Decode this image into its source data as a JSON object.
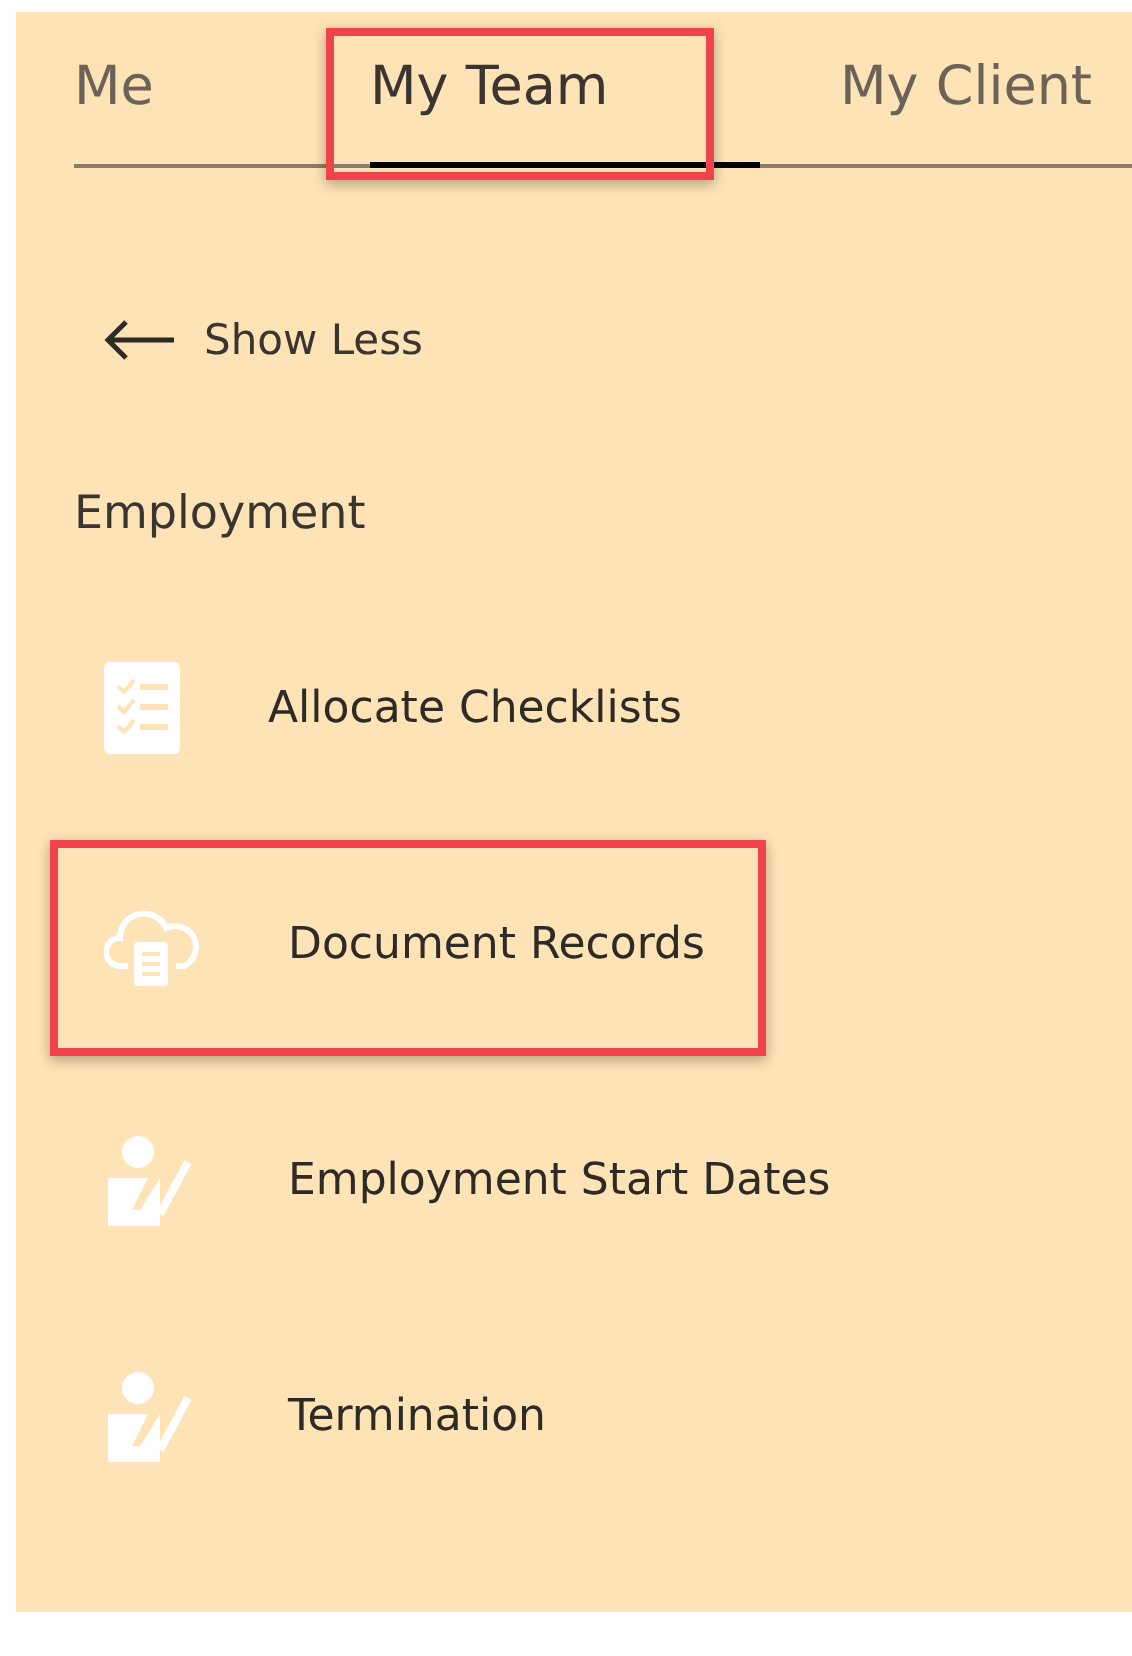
{
  "tabs": [
    {
      "label": "Me",
      "selected": false,
      "highlighted": false
    },
    {
      "label": "My Team",
      "selected": true,
      "highlighted": true
    },
    {
      "label": "My Client",
      "selected": false,
      "highlighted": false
    }
  ],
  "back_link": {
    "label": "Show Less"
  },
  "section": {
    "title": "Employment"
  },
  "items": [
    {
      "label": "Allocate Checklists",
      "kind": "checklist",
      "highlighted": false
    },
    {
      "label": "Document Records",
      "kind": "cloud-document",
      "highlighted": true
    },
    {
      "label": "Employment Start Dates",
      "kind": "person-edit",
      "highlighted": false
    },
    {
      "label": "Termination",
      "kind": "person-edit",
      "highlighted": false
    }
  ]
}
